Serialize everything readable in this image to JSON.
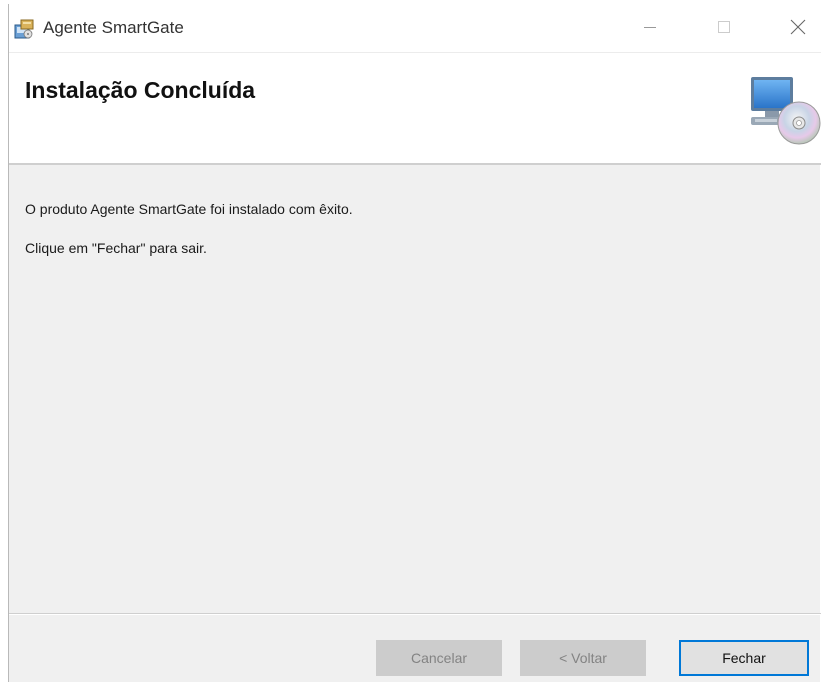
{
  "window": {
    "title": "Agente SmartGate",
    "controls": {
      "minimize_icon": "minimize-icon",
      "maximize_icon": "maximize-icon",
      "close_icon": "close-icon"
    }
  },
  "banner": {
    "title": "Instalação Concluída",
    "graphic_icon": "computer-cd-icon"
  },
  "content": {
    "message_1": "O produto Agente SmartGate foi instalado com êxito.",
    "message_2": "Clique em \"Fechar\" para sair."
  },
  "footer": {
    "cancel_label": "Cancelar",
    "cancel_enabled": false,
    "back_label": "< Voltar",
    "back_enabled": false,
    "close_label": "Fechar",
    "close_enabled": true
  },
  "colors": {
    "focus_border": "#0078d7",
    "dialog_background": "#f0f0f0",
    "disabled_button": "#cccccc"
  }
}
